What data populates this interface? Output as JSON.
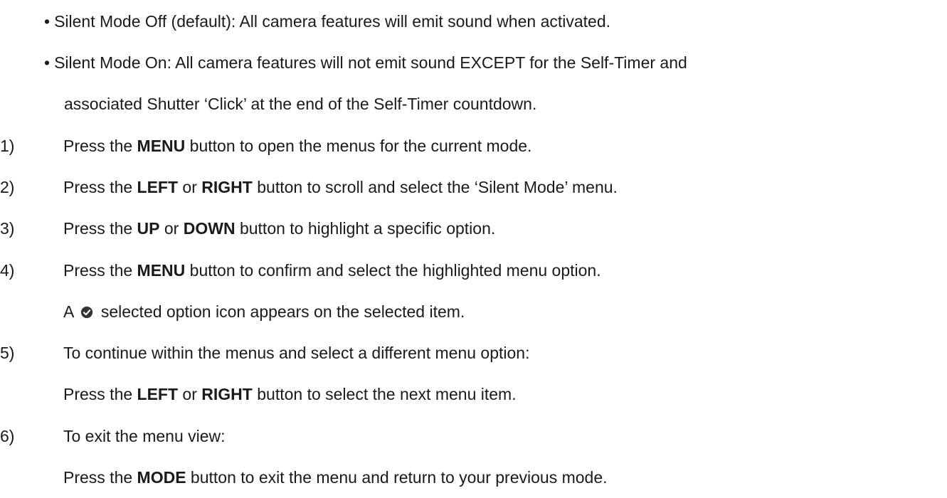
{
  "bullets": [
    {
      "dot": "•",
      "text": "Silent Mode Off (default): All camera features will emit sound when activated."
    },
    {
      "dot": "•",
      "text": "Silent Mode On: All camera features will not emit sound EXCEPT for the Self-Timer and",
      "continuation": "associated Shutter ‘Click’ at the end of the Self-Timer countdown."
    }
  ],
  "steps": [
    {
      "number": "1)",
      "pre": "Press the ",
      "b1": "MENU",
      "post": " button to open the menus for the current mode."
    },
    {
      "number": "2)",
      "pre": "Press the ",
      "b1": "LEFT",
      "mid": " or ",
      "b2": "RIGHT",
      "post": " button to scroll and select the ‘Silent Mode’ menu."
    },
    {
      "number": "3)",
      "pre": "Press the ",
      "b1": "UP",
      "mid": " or ",
      "b2": "DOWN",
      "post": " button to highlight a specific option."
    },
    {
      "number": "4)",
      "pre": "Press the ",
      "b1": "MENU",
      "post": " button to confirm and select the highlighted menu option.",
      "note_pre": "A",
      "note_icon": "check-circle-icon",
      "note_post": "selected option icon appears on the selected item."
    },
    {
      "number": "5)",
      "text": "To continue within the menus and select a different menu option:",
      "sub_pre": "Press the ",
      "sub_b1": "LEFT",
      "sub_mid": " or ",
      "sub_b2": "RIGHT",
      "sub_post": " button to select the next menu item."
    },
    {
      "number": "6)",
      "text": "To exit the menu view:",
      "sub_pre": "Press the ",
      "sub_b1": "MODE",
      "sub_post": " button to exit the menu and return to your previous mode."
    }
  ],
  "colors": {
    "text": "#1a1a1a",
    "background": "#ffffff"
  }
}
